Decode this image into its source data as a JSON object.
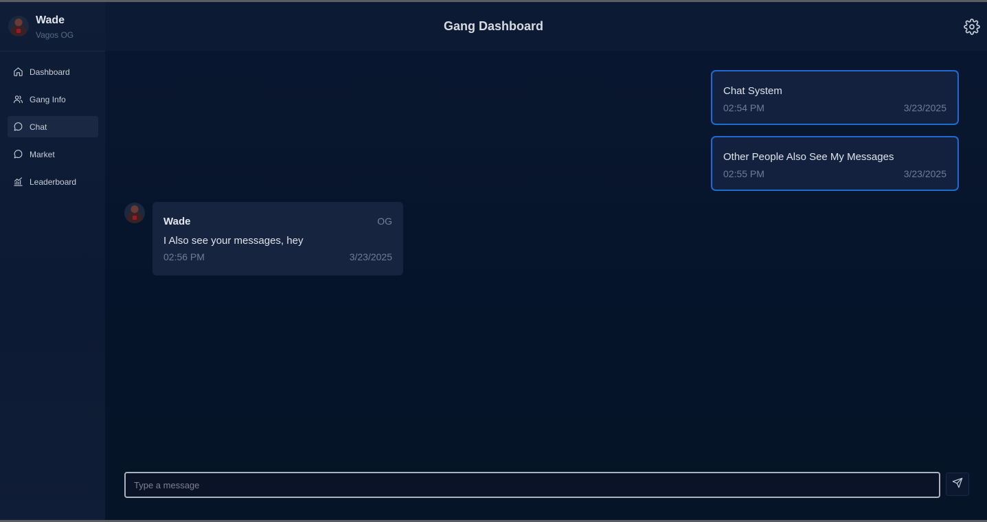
{
  "profile": {
    "name": "Wade",
    "rank": "Vagos OG"
  },
  "header": {
    "title": "Gang Dashboard"
  },
  "nav": {
    "items": [
      {
        "label": "Dashboard",
        "icon": "home-icon"
      },
      {
        "label": "Gang Info",
        "icon": "users-icon"
      },
      {
        "label": "Chat",
        "icon": "chat-icon",
        "active": true
      },
      {
        "label": "Market",
        "icon": "chat-icon"
      },
      {
        "label": "Leaderboard",
        "icon": "chart-icon"
      }
    ]
  },
  "chat": {
    "outgoing": [
      {
        "text": "Chat System",
        "time": "02:54 PM",
        "date": "3/23/2025"
      },
      {
        "text": "Other People Also See My Messages",
        "time": "02:55 PM",
        "date": "3/23/2025"
      }
    ],
    "incoming": [
      {
        "sender": "Wade",
        "rank": "OG",
        "text": "I Also see your messages, hey",
        "time": "02:56 PM",
        "date": "3/23/2025"
      }
    ]
  },
  "composer": {
    "placeholder": "Type a message",
    "value": ""
  },
  "colors": {
    "accent": "#1e6bd3",
    "background": "#06142b",
    "sidebar": "#0f1d37"
  }
}
